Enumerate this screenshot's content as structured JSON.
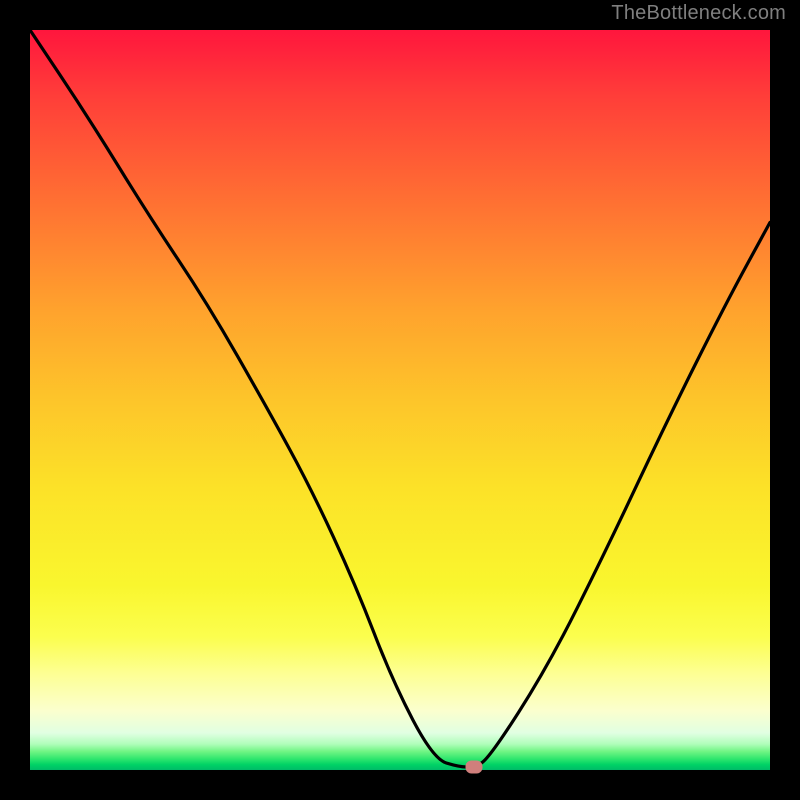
{
  "attribution": "TheBottleneck.com",
  "colors": {
    "page_bg": "#000000",
    "curve": "#000000",
    "marker": "#d07f7c",
    "attribution_text": "#7f7f7f"
  },
  "chart_data": {
    "type": "line",
    "title": "",
    "xlabel": "",
    "ylabel": "",
    "xlim": [
      0,
      100
    ],
    "ylim": [
      0,
      100
    ],
    "x": [
      0,
      8,
      16,
      24,
      32,
      38,
      44,
      49,
      54.5,
      58,
      60,
      62,
      70,
      78,
      86,
      94,
      100
    ],
    "values": [
      100,
      88,
      75,
      63,
      49,
      38,
      25,
      12,
      1.5,
      0.4,
      0.4,
      1.5,
      14,
      30,
      47,
      63,
      74
    ],
    "marker_x": 60,
    "marker_y": 0.4,
    "notes": "Axes are unlabeled in the image; values are estimated from pixel positions within the gradient plot area. Y axis is percent-like (0 bottom, 100 top). Curve is a V-shape with minimum flat segment near x≈58–62."
  }
}
